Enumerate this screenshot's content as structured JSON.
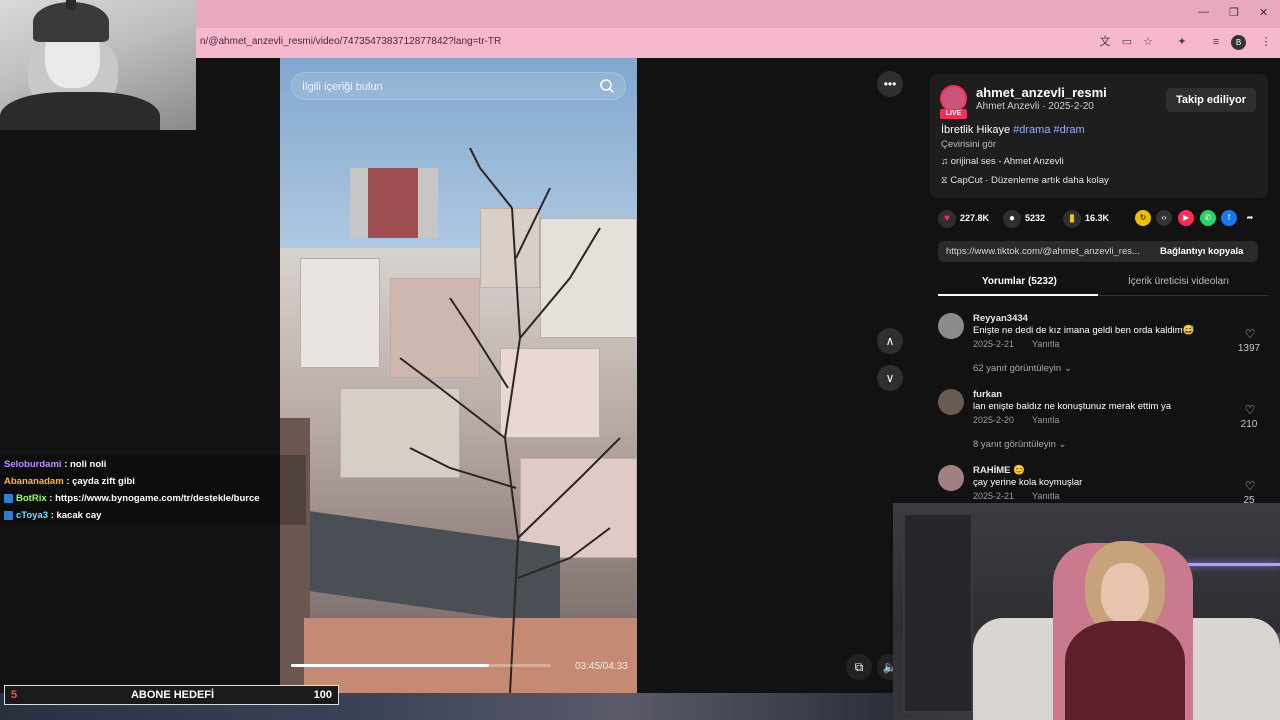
{
  "browser": {
    "url": "n/@ahmet_anzevli_resmi/video/7473547383712877842?lang=tr-TR",
    "profile_initial": "B",
    "window_controls": [
      "—",
      "❐",
      "✕"
    ]
  },
  "video": {
    "search_placeholder": "İlgili içeriği bulun",
    "time": "03:45/04:33",
    "progress": 0.76
  },
  "post": {
    "username": "ahmet_anzevli_resmi",
    "sub": "Ahmet Anzevli · 2025-2-20",
    "live_label": "LIVE",
    "follow_label": "Takip ediliyor",
    "desc_text": "İbretlik Hikaye ",
    "tags": "#drama #dram",
    "translate": "Çevirisini gör",
    "sound": "orijinal ses - Ahmet Anzevli",
    "capcut": "CapCut · Düzenleme artık daha kolay"
  },
  "stats": {
    "likes": "227.8K",
    "comments": "5232",
    "saves": "16.3K"
  },
  "link": {
    "url": "https://www.tiktok.com/@ahmet_anzevli_res...",
    "copy_label": "Bağlantıyı kopyala"
  },
  "tabs": {
    "comments": "Yorumlar (5232)",
    "creator_videos": "İçerik üreticisi videoları"
  },
  "comments": [
    {
      "user": "Reyyan3434",
      "text": "Enişte ne dedi de kız imana geldi ben orda kaldim😅",
      "date": "2025-2-21",
      "reply": "Yanıtla",
      "likes": "1397",
      "replies": "62 yanıt görüntüleyin ⌄"
    },
    {
      "user": "furkan",
      "text": "lan enişte baldız ne konuştunuz merak ettim ya",
      "date": "2025-2-20",
      "reply": "Yanıtla",
      "likes": "210",
      "replies": "8 yanıt görüntüleyin ⌄"
    },
    {
      "user": "RAHİME 😊",
      "text": "çay yerine kola koymuşlar",
      "date": "2025-2-21",
      "reply": "Yanıtla",
      "likes": "25",
      "replies": ""
    }
  ],
  "chat": [
    {
      "user": "Seloburdami",
      "msg": ": noli noli",
      "color": "#c38cff"
    },
    {
      "user": "Abananadam",
      "msg": ": çayda zift gibi",
      "color": "#ffb347"
    },
    {
      "user": "BotRix",
      "msg": ": https://www.bynogame.com/tr/destekle/burce",
      "color": "#9bff6a"
    },
    {
      "user": "cToya3",
      "msg": ": kacak cay",
      "color": "#6ae0ff"
    }
  ],
  "goal": {
    "current": "5",
    "label": "ABONE HEDEFİ",
    "target": "100"
  },
  "colors": {
    "accent": "#fe2c55",
    "tag": "#8ab4ff",
    "chrome": "#f7b7cd"
  }
}
